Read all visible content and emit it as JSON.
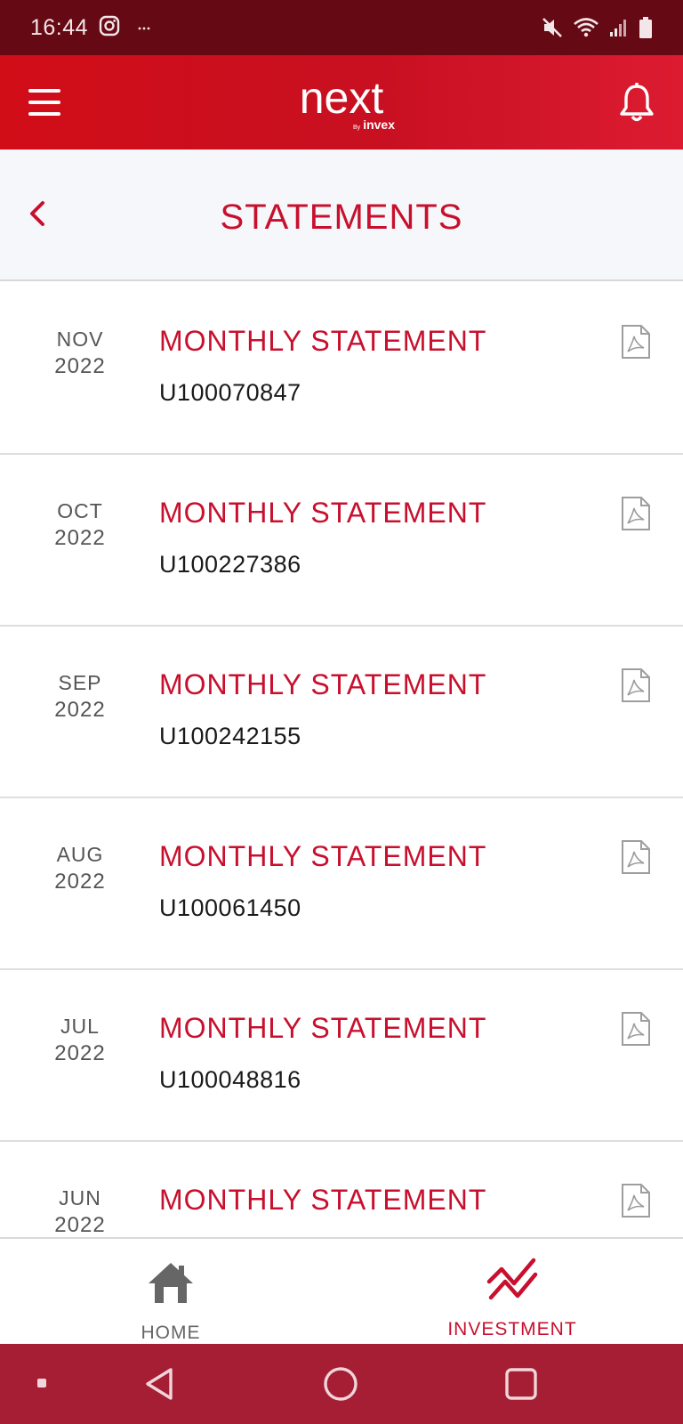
{
  "status_bar": {
    "time": "16:44",
    "left_icons": [
      "instagram-icon",
      "more-dots-icon"
    ],
    "right_icons": [
      "mute-icon",
      "wifi-icon",
      "signal-icon",
      "battery-icon"
    ]
  },
  "header": {
    "logo_main": "next",
    "logo_by": "By",
    "logo_brand": "invex",
    "menu_icon": "hamburger-icon",
    "bell_icon": "bell-icon",
    "background_color": "#c8102e"
  },
  "title_band": {
    "title": "STATEMENTS",
    "back_icon": "chevron-left-icon"
  },
  "statements": [
    {
      "month": "NOV",
      "year": "2022",
      "title": "MONTHLY STATEMENT",
      "number": "U100070847",
      "icon": "pdf-icon"
    },
    {
      "month": "OCT",
      "year": "2022",
      "title": "MONTHLY STATEMENT",
      "number": "U100227386",
      "icon": "pdf-icon"
    },
    {
      "month": "SEP",
      "year": "2022",
      "title": "MONTHLY STATEMENT",
      "number": "U100242155",
      "icon": "pdf-icon"
    },
    {
      "month": "AUG",
      "year": "2022",
      "title": "MONTHLY STATEMENT",
      "number": "U100061450",
      "icon": "pdf-icon"
    },
    {
      "month": "JUL",
      "year": "2022",
      "title": "MONTHLY STATEMENT",
      "number": "U100048816",
      "icon": "pdf-icon"
    },
    {
      "month": "JUN",
      "year": "2022",
      "title": "MONTHLY STATEMENT",
      "number": "",
      "icon": "pdf-icon"
    }
  ],
  "bottom_nav": {
    "items": [
      {
        "label": "HOME",
        "icon": "home-icon",
        "active": false,
        "color": "#666666"
      },
      {
        "label": "INVESTMENT",
        "icon": "investment-chart-icon",
        "active": true,
        "color": "#c8102e"
      }
    ]
  },
  "system_nav": {
    "buttons": [
      "recents-dot-icon",
      "back-triangle-icon",
      "home-circle-icon",
      "overview-square-icon"
    ],
    "background_color": "#a51e34"
  },
  "colors": {
    "accent": "#c8102e",
    "status_bar": "#650a14",
    "title_band_bg": "#f5f7fa",
    "text_dark": "#1a1a1a",
    "text_muted": "#555555"
  }
}
